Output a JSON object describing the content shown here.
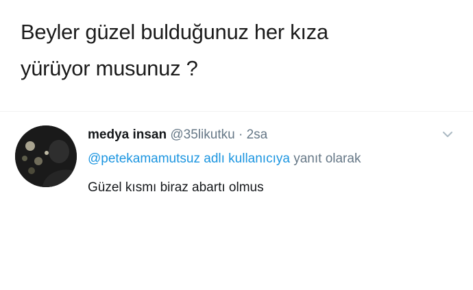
{
  "caption": {
    "line1": "Beyler güzel bulduğunuz her kıza",
    "line2": "yürüyor musunuz ?"
  },
  "tweet": {
    "display_name": "medya insan",
    "handle": "@35likutku",
    "separator": "·",
    "time": "2sa",
    "reply_to_handle": "@petekamamutsuz",
    "reply_context_mid": "adlı kullanıcıya",
    "reply_context_end": "yanıt olarak",
    "text": "Güzel kısmı biraz abartı olmus",
    "menu_icon": "chevron-down-icon",
    "avatar_icon": "avatar"
  },
  "colors": {
    "link": "#1b95e0",
    "secondary_text": "#657786",
    "primary_text": "#14171a"
  }
}
